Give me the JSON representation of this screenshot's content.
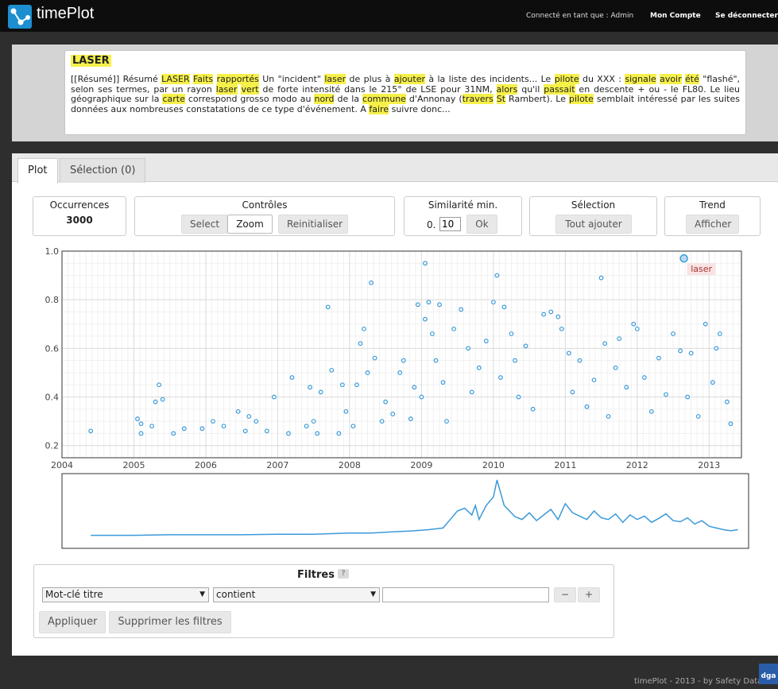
{
  "header": {
    "app_name": "timePlot",
    "logged_in_text": "Connecté en tant que : Admin",
    "account_link": "Mon Compte",
    "logout_link": "Se déconnecter"
  },
  "document": {
    "title": "LASER",
    "excerpt": "[[Résumé]] Résumé LASER Faits rapportés Un \"incident\" laser de plus à ajouter à la liste des incidents... Le pilote du XXX : signale avoir été \"flashé\", selon ses termes, par un rayon laser vert de forte intensité dans le 215° de LSE pour 31NM, alors qu'il passait en descente + ou - le FL80. Le lieu géographique sur la carte correspond grosso modo au nord de la commune d'Annonay (travers St Rambert). Le pilote semblait intéressé par les suites données aux nombreuses constatations de ce type d'événement. A faire suivre donc...",
    "highlight_color": "#f6f04a"
  },
  "tabs": [
    {
      "label": "Plot",
      "active": true
    },
    {
      "label": "Sélection (0)",
      "active": false
    }
  ],
  "controls": {
    "occurrences": {
      "label": "Occurrences",
      "value": "3000"
    },
    "controles": {
      "label": "Contrôles",
      "select": "Select",
      "zoom": "Zoom",
      "reset": "Reinitialiser",
      "active_mode": "Zoom"
    },
    "similarity": {
      "label": "Similarité min.",
      "prefix": "0.",
      "input_value": "10",
      "ok": "Ok"
    },
    "selection": {
      "label": "Sélection",
      "add_all": "Tout ajouter"
    },
    "trend": {
      "label": "Trend",
      "show": "Afficher"
    }
  },
  "chart_data": [
    {
      "type": "scatter",
      "xlabel": "",
      "ylabel": "",
      "x_ticks": [
        "2004",
        "2005",
        "2006",
        "2007",
        "2008",
        "2009",
        "2010",
        "2011",
        "2012",
        "2013"
      ],
      "y_ticks": [
        "0.2",
        "0.4",
        "0.6",
        "0.8",
        "1.0"
      ],
      "xlim": [
        2004.0,
        2013.45
      ],
      "ylim": [
        0.15,
        1.0
      ],
      "grid": true,
      "point_color": "#3a9ad9",
      "highlight": {
        "x": 2012.65,
        "y": 0.97,
        "label": "laser"
      },
      "approx_points": [
        {
          "x": 2004.4,
          "y": 0.26
        },
        {
          "x": 2005.05,
          "y": 0.31
        },
        {
          "x": 2005.1,
          "y": 0.29
        },
        {
          "x": 2005.1,
          "y": 0.25
        },
        {
          "x": 2005.3,
          "y": 0.38
        },
        {
          "x": 2005.35,
          "y": 0.45
        },
        {
          "x": 2005.4,
          "y": 0.39
        },
        {
          "x": 2005.25,
          "y": 0.28
        },
        {
          "x": 2005.55,
          "y": 0.25
        },
        {
          "x": 2005.7,
          "y": 0.27
        },
        {
          "x": 2005.95,
          "y": 0.27
        },
        {
          "x": 2006.1,
          "y": 0.3
        },
        {
          "x": 2006.25,
          "y": 0.28
        },
        {
          "x": 2006.45,
          "y": 0.34
        },
        {
          "x": 2006.55,
          "y": 0.26
        },
        {
          "x": 2006.6,
          "y": 0.32
        },
        {
          "x": 2006.7,
          "y": 0.3
        },
        {
          "x": 2006.85,
          "y": 0.26
        },
        {
          "x": 2006.95,
          "y": 0.4
        },
        {
          "x": 2007.15,
          "y": 0.25
        },
        {
          "x": 2007.2,
          "y": 0.48
        },
        {
          "x": 2007.4,
          "y": 0.28
        },
        {
          "x": 2007.45,
          "y": 0.44
        },
        {
          "x": 2007.5,
          "y": 0.3
        },
        {
          "x": 2007.55,
          "y": 0.25
        },
        {
          "x": 2007.6,
          "y": 0.42
        },
        {
          "x": 2007.7,
          "y": 0.77
        },
        {
          "x": 2007.75,
          "y": 0.51
        },
        {
          "x": 2007.85,
          "y": 0.25
        },
        {
          "x": 2007.9,
          "y": 0.45
        },
        {
          "x": 2007.95,
          "y": 0.34
        },
        {
          "x": 2008.05,
          "y": 0.28
        },
        {
          "x": 2008.1,
          "y": 0.45
        },
        {
          "x": 2008.15,
          "y": 0.62
        },
        {
          "x": 2008.2,
          "y": 0.68
        },
        {
          "x": 2008.25,
          "y": 0.5
        },
        {
          "x": 2008.3,
          "y": 0.87
        },
        {
          "x": 2008.35,
          "y": 0.56
        },
        {
          "x": 2008.45,
          "y": 0.3
        },
        {
          "x": 2008.5,
          "y": 0.38
        },
        {
          "x": 2008.6,
          "y": 0.33
        },
        {
          "x": 2008.7,
          "y": 0.5
        },
        {
          "x": 2008.75,
          "y": 0.55
        },
        {
          "x": 2008.85,
          "y": 0.31
        },
        {
          "x": 2008.9,
          "y": 0.44
        },
        {
          "x": 2008.95,
          "y": 0.78
        },
        {
          "x": 2009.0,
          "y": 0.4
        },
        {
          "x": 2009.05,
          "y": 0.72
        },
        {
          "x": 2009.05,
          "y": 0.95
        },
        {
          "x": 2009.1,
          "y": 0.79
        },
        {
          "x": 2009.15,
          "y": 0.66
        },
        {
          "x": 2009.2,
          "y": 0.55
        },
        {
          "x": 2009.25,
          "y": 0.78
        },
        {
          "x": 2009.3,
          "y": 0.46
        },
        {
          "x": 2009.35,
          "y": 0.3
        },
        {
          "x": 2009.45,
          "y": 0.68
        },
        {
          "x": 2009.55,
          "y": 0.76
        },
        {
          "x": 2009.65,
          "y": 0.6
        },
        {
          "x": 2009.7,
          "y": 0.42
        },
        {
          "x": 2009.8,
          "y": 0.52
        },
        {
          "x": 2009.9,
          "y": 0.63
        },
        {
          "x": 2010.0,
          "y": 0.79
        },
        {
          "x": 2010.05,
          "y": 0.9
        },
        {
          "x": 2010.1,
          "y": 0.48
        },
        {
          "x": 2010.15,
          "y": 0.77
        },
        {
          "x": 2010.25,
          "y": 0.66
        },
        {
          "x": 2010.3,
          "y": 0.55
        },
        {
          "x": 2010.35,
          "y": 0.4
        },
        {
          "x": 2010.45,
          "y": 0.61
        },
        {
          "x": 2010.55,
          "y": 0.35
        },
        {
          "x": 2010.7,
          "y": 0.74
        },
        {
          "x": 2010.8,
          "y": 0.75
        },
        {
          "x": 2010.9,
          "y": 0.73
        },
        {
          "x": 2010.95,
          "y": 0.68
        },
        {
          "x": 2011.05,
          "y": 0.58
        },
        {
          "x": 2011.1,
          "y": 0.42
        },
        {
          "x": 2011.2,
          "y": 0.55
        },
        {
          "x": 2011.3,
          "y": 0.36
        },
        {
          "x": 2011.4,
          "y": 0.47
        },
        {
          "x": 2011.5,
          "y": 0.89
        },
        {
          "x": 2011.55,
          "y": 0.62
        },
        {
          "x": 2011.6,
          "y": 0.32
        },
        {
          "x": 2011.7,
          "y": 0.52
        },
        {
          "x": 2011.75,
          "y": 0.64
        },
        {
          "x": 2011.85,
          "y": 0.44
        },
        {
          "x": 2011.95,
          "y": 0.7
        },
        {
          "x": 2012.0,
          "y": 0.68
        },
        {
          "x": 2012.1,
          "y": 0.48
        },
        {
          "x": 2012.2,
          "y": 0.34
        },
        {
          "x": 2012.3,
          "y": 0.56
        },
        {
          "x": 2012.4,
          "y": 0.41
        },
        {
          "x": 2012.5,
          "y": 0.66
        },
        {
          "x": 2012.6,
          "y": 0.59
        },
        {
          "x": 2012.7,
          "y": 0.4
        },
        {
          "x": 2012.75,
          "y": 0.58
        },
        {
          "x": 2012.85,
          "y": 0.32
        },
        {
          "x": 2012.95,
          "y": 0.7
        },
        {
          "x": 2013.05,
          "y": 0.46
        },
        {
          "x": 2013.1,
          "y": 0.6
        },
        {
          "x": 2013.15,
          "y": 0.66
        },
        {
          "x": 2013.25,
          "y": 0.38
        },
        {
          "x": 2013.3,
          "y": 0.29
        }
      ]
    },
    {
      "type": "line",
      "xlabel": "",
      "ylabel": "",
      "x": [
        2004.4,
        2005.0,
        2005.5,
        2006.0,
        2006.5,
        2007.0,
        2007.5,
        2008.0,
        2008.3,
        2008.6,
        2008.9,
        2009.1,
        2009.3,
        2009.4,
        2009.5,
        2009.6,
        2009.7,
        2009.75,
        2009.8,
        2009.9,
        2010.0,
        2010.05,
        2010.15,
        2010.3,
        2010.4,
        2010.5,
        2010.6,
        2010.7,
        2010.8,
        2010.9,
        2011.0,
        2011.1,
        2011.2,
        2011.3,
        2011.4,
        2011.5,
        2011.6,
        2011.7,
        2011.8,
        2011.9,
        2012.0,
        2012.1,
        2012.2,
        2012.3,
        2012.4,
        2012.5,
        2012.6,
        2012.7,
        2012.8,
        2012.9,
        2013.0,
        2013.1,
        2013.2,
        2013.3,
        2013.4
      ],
      "values": [
        0.02,
        0.02,
        0.03,
        0.03,
        0.03,
        0.04,
        0.04,
        0.06,
        0.06,
        0.08,
        0.1,
        0.12,
        0.15,
        0.3,
        0.45,
        0.5,
        0.38,
        0.55,
        0.3,
        0.55,
        0.7,
        1.0,
        0.55,
        0.35,
        0.3,
        0.42,
        0.28,
        0.38,
        0.48,
        0.3,
        0.58,
        0.42,
        0.36,
        0.3,
        0.45,
        0.33,
        0.3,
        0.4,
        0.25,
        0.38,
        0.3,
        0.36,
        0.25,
        0.32,
        0.4,
        0.28,
        0.26,
        0.33,
        0.22,
        0.28,
        0.18,
        0.15,
        0.12,
        0.1,
        0.12
      ],
      "grid": false,
      "color": "#3a9ad9"
    }
  ],
  "filters": {
    "title": "Filtres",
    "help": "?",
    "field_select": "Mot-clé titre",
    "operator_select": "contient",
    "value": "",
    "minus": "−",
    "plus": "+",
    "apply": "Appliquer",
    "remove": "Supprimer les filtres"
  },
  "footer": {
    "text": "timePlot - 2013 - by Safety Data™ for",
    "logo": "dga"
  }
}
